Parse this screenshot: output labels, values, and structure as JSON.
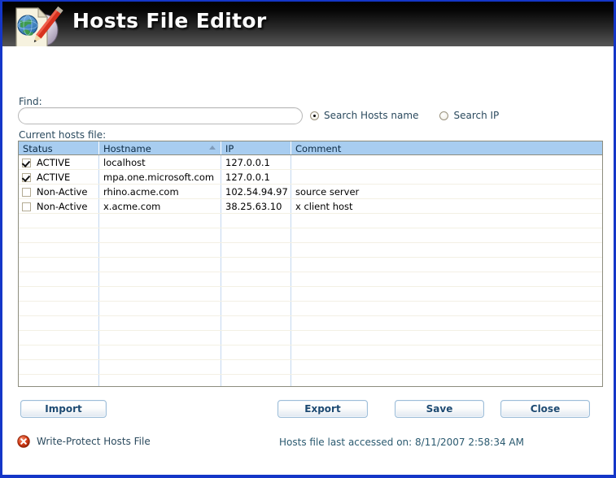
{
  "window": {
    "border_color": "#1436c8"
  },
  "header": {
    "title": "Hosts File Editor",
    "icon": "hosts-file-document-globe-pencil-icon"
  },
  "search": {
    "find_label": "Find:",
    "find_value": "",
    "find_placeholder": "",
    "options": [
      {
        "label": "Search Hosts name",
        "selected": true
      },
      {
        "label": "Search IP",
        "selected": false
      }
    ]
  },
  "table": {
    "caption": "Current hosts file:",
    "columns": [
      {
        "key": "status",
        "label": "Status",
        "sorted": false
      },
      {
        "key": "hostname",
        "label": "Hostname",
        "sorted": true,
        "sort_dir": "asc"
      },
      {
        "key": "ip",
        "label": "IP",
        "sorted": false
      },
      {
        "key": "comment",
        "label": "Comment",
        "sorted": false
      }
    ],
    "rows": [
      {
        "checked": true,
        "status": "ACTIVE",
        "hostname": "localhost",
        "ip": "127.0.0.1",
        "comment": ""
      },
      {
        "checked": true,
        "status": "ACTIVE",
        "hostname": "mpa.one.microsoft.com",
        "ip": "127.0.0.1",
        "comment": ""
      },
      {
        "checked": false,
        "status": "Non-Active",
        "hostname": "rhino.acme.com",
        "ip": "102.54.94.97",
        "comment": "source server"
      },
      {
        "checked": false,
        "status": "Non-Active",
        "hostname": "x.acme.com",
        "ip": "38.25.63.10",
        "comment": "x client host"
      }
    ],
    "empty_row_count": 12
  },
  "buttons": {
    "import": "Import",
    "export": "Export",
    "save": "Save",
    "close": "Close"
  },
  "footer": {
    "write_protect_label": "Write-Protect Hosts File",
    "write_protect_icon": "red-x-circle-icon",
    "last_accessed": "Hosts file last accessed on: 8/11/2007 2:58:34 AM"
  }
}
